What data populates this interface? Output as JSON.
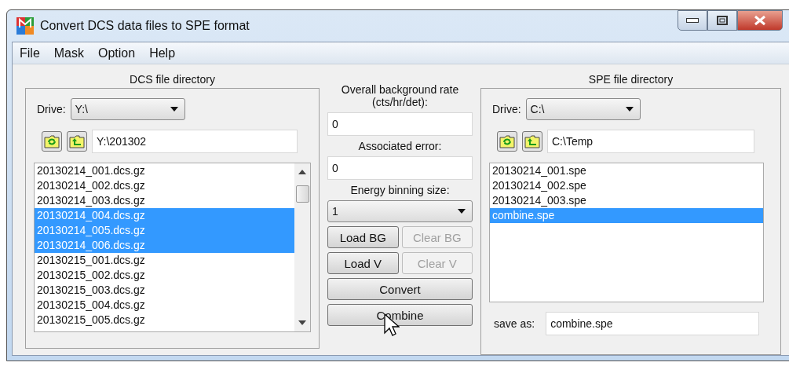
{
  "window": {
    "title": "Convert DCS data files to SPE format"
  },
  "menu": [
    "File",
    "Mask",
    "Option",
    "Help"
  ],
  "dcs_panel": {
    "heading": "DCS file directory",
    "drive_label": "Drive:",
    "drive": "Y:\\",
    "path": "Y:\\201302",
    "files": [
      {
        "name": "20130214_001.dcs.gz",
        "selected": false
      },
      {
        "name": "20130214_002.dcs.gz",
        "selected": false
      },
      {
        "name": "20130214_003.dcs.gz",
        "selected": false
      },
      {
        "name": "20130214_004.dcs.gz",
        "selected": true
      },
      {
        "name": "20130214_005.dcs.gz",
        "selected": true
      },
      {
        "name": "20130214_006.dcs.gz",
        "selected": true
      },
      {
        "name": "20130215_001.dcs.gz",
        "selected": false
      },
      {
        "name": "20130215_002.dcs.gz",
        "selected": false
      },
      {
        "name": "20130215_003.dcs.gz",
        "selected": false
      },
      {
        "name": "20130215_004.dcs.gz",
        "selected": false
      },
      {
        "name": "20130215_005.dcs.gz",
        "selected": false
      }
    ]
  },
  "middle": {
    "background_label": "Overall background rate (cts/hr/det):",
    "background": "0",
    "error_label": "Associated error:",
    "error": "0",
    "binning_label": "Energy binning size:",
    "binning": "1",
    "button_rows": [
      [
        {
          "label": "Load BG",
          "disabled": false
        },
        {
          "label": "Clear BG",
          "disabled": true
        }
      ],
      [
        {
          "label": "Load V",
          "disabled": false
        },
        {
          "label": "Clear V",
          "disabled": true
        }
      ],
      [
        {
          "label": "Convert",
          "disabled": false
        }
      ],
      [
        {
          "label": "Combine",
          "disabled": false
        }
      ]
    ]
  },
  "spe_panel": {
    "heading": "SPE file directory",
    "drive_label": "Drive:",
    "drive": "C:\\",
    "path": "C:\\Temp",
    "files": [
      {
        "name": "20130214_001.spe",
        "selected": false
      },
      {
        "name": "20130214_002.spe",
        "selected": false
      },
      {
        "name": "20130214_003.spe",
        "selected": false
      },
      {
        "name": "combine.spe",
        "selected": true
      }
    ],
    "save_label": "save as:",
    "save_name": "combine.spe"
  }
}
